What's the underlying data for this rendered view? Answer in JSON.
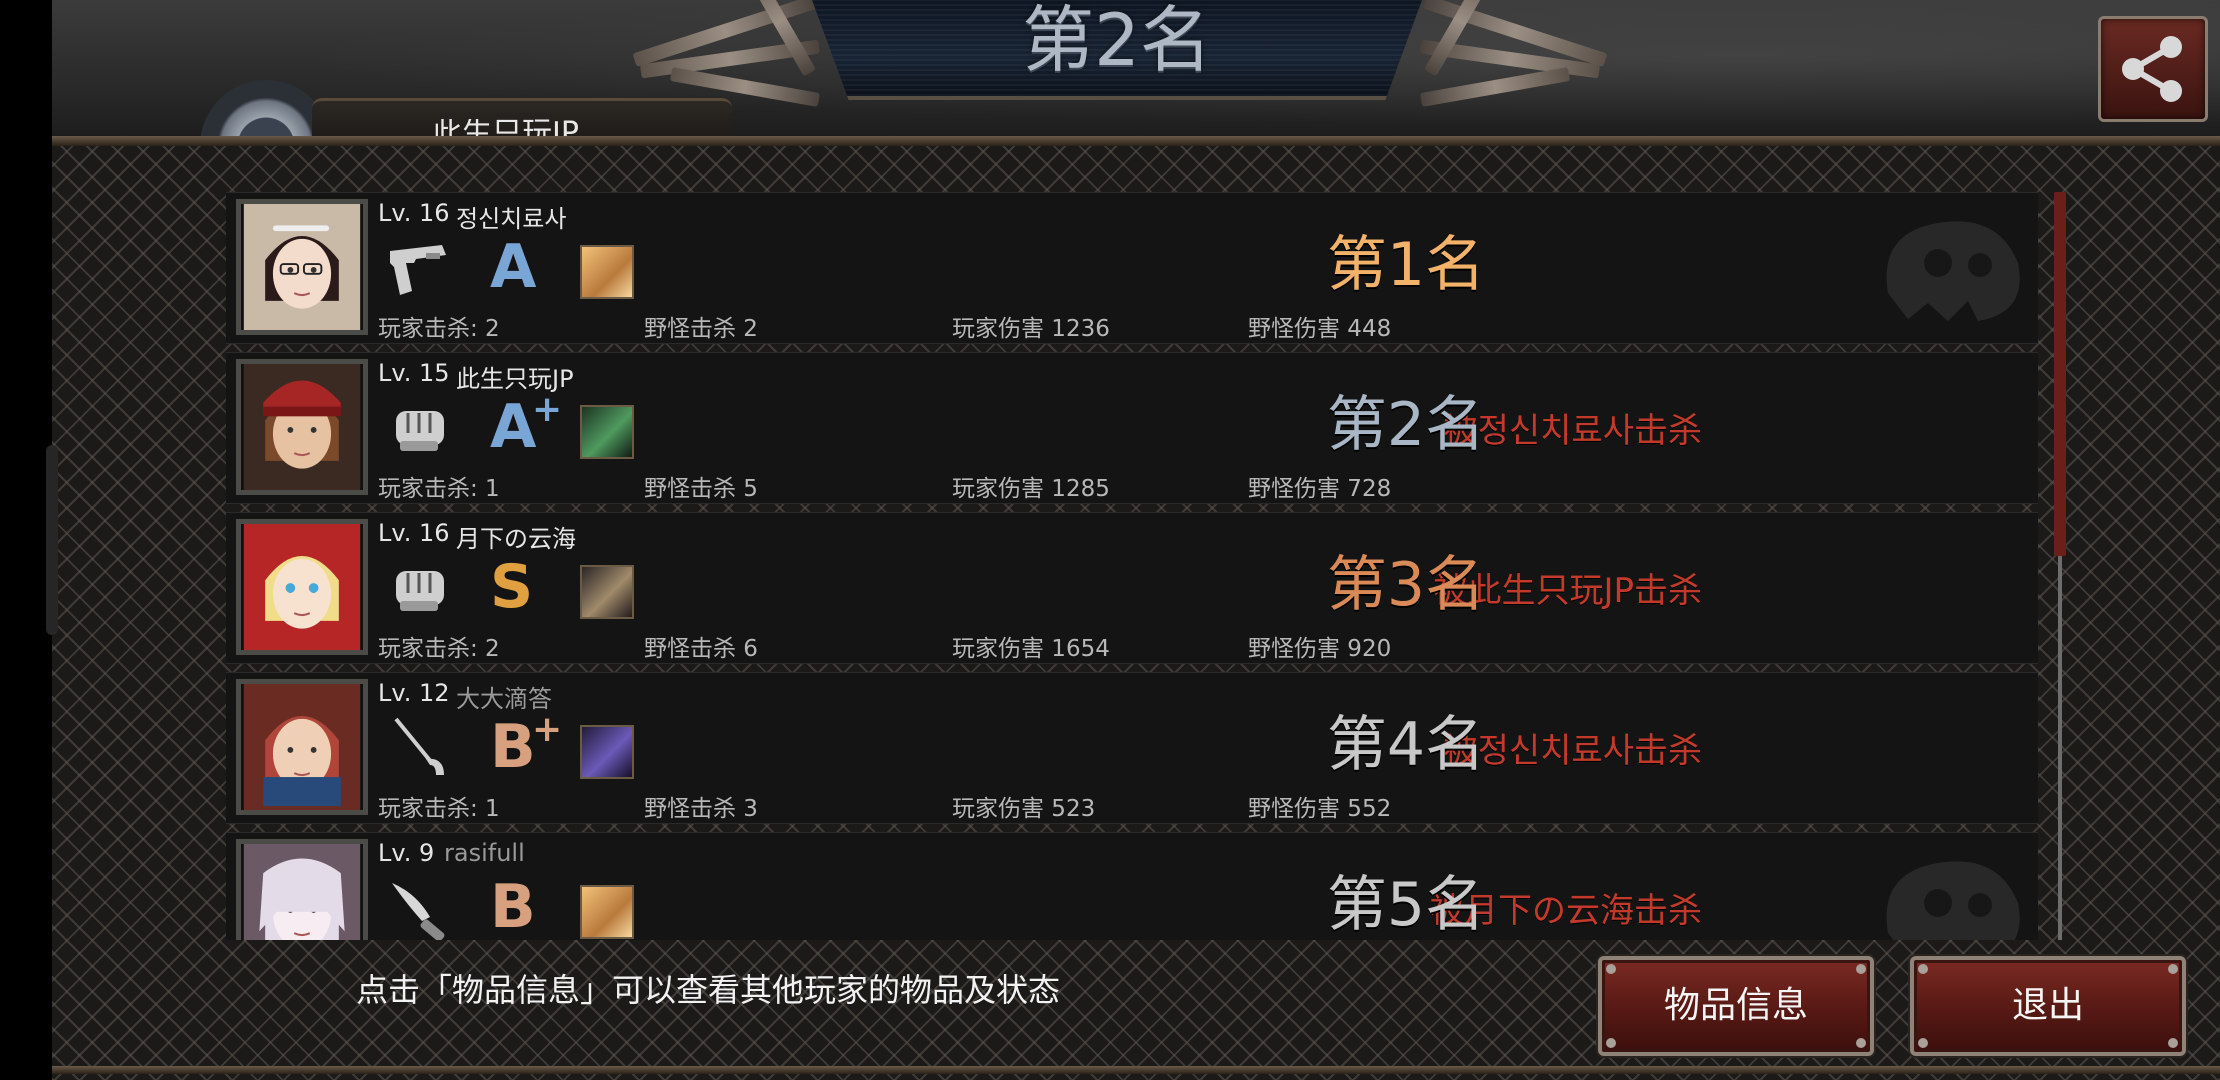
{
  "header": {
    "title": "第2名",
    "header_name_partial": "此生只玩JP"
  },
  "players": [
    {
      "level": "Lv. 16",
      "name": "정신치료사",
      "name_color": "#e6e6e6",
      "weapon": "pistol-icon",
      "grade": "A",
      "grade_plus": "",
      "grade_color": "#7aa6d6",
      "item": "gold-item-icon",
      "player_kills": "玩家击杀: 2",
      "monster_kills": "野怪击杀 2",
      "player_damage": "玩家伤害 1236",
      "monster_damage": "野怪伤害 448",
      "killed_by": "",
      "rank": "第1名",
      "rank_color": "#f2b26a",
      "portrait": "portrait-girl-glasses",
      "emblem": true
    },
    {
      "level": "Lv. 15",
      "name": "此生只玩JP",
      "name_color": "#e6e6e6",
      "weapon": "fist-icon",
      "grade": "A",
      "grade_plus": "+",
      "grade_color": "#7aa6d6",
      "item": "green-item-icon",
      "player_kills": "玩家击杀: 1",
      "monster_kills": "野怪击杀 5",
      "player_damage": "玩家伤害 1285",
      "monster_damage": "野怪伤害 728",
      "killed_by": "被정신치료사击杀",
      "rank": "第2名",
      "rank_color": "#a9b6c6",
      "portrait": "portrait-red-beanie",
      "emblem": false
    },
    {
      "level": "Lv. 16",
      "name": "月下の云海",
      "name_color": "#e6e6e6",
      "weapon": "fist-icon",
      "grade": "S",
      "grade_plus": "",
      "grade_color": "#e0a040",
      "item": "dark-character-item-icon",
      "player_kills": "玩家击杀: 2",
      "monster_kills": "野怪击杀 6",
      "player_damage": "玩家伤害 1654",
      "monster_damage": "野怪伤害 920",
      "killed_by": "被此生只玩JP击杀",
      "rank": "第3名",
      "rank_color": "#d98a56",
      "portrait": "portrait-blonde",
      "emblem": false
    },
    {
      "level": "Lv. 12",
      "name": "大大滴答",
      "name_color": "#9a9a9a",
      "weapon": "rapier-icon",
      "grade": "B",
      "grade_plus": "+",
      "grade_color": "#d7a07e",
      "item": "purple-item-icon",
      "player_kills": "玩家击杀: 1",
      "monster_kills": "野怪击杀 3",
      "player_damage": "玩家伤害 523",
      "monster_damage": "野怪伤害 552",
      "killed_by": "被정신치료사击杀",
      "rank": "第4名",
      "rank_color": "#c8c8c8",
      "portrait": "portrait-redhead",
      "emblem": false
    },
    {
      "level": "Lv. 9",
      "name": "rasifull",
      "name_color": "#9a9a9a",
      "weapon": "knife-icon",
      "grade": "B",
      "grade_plus": "",
      "grade_color": "#d7a07e",
      "item": "gold-item-icon",
      "player_kills": "",
      "monster_kills": "",
      "player_damage": "",
      "monster_damage": "",
      "killed_by": "被月下の云海击杀",
      "rank": "第5名",
      "rank_color": "#c8c8c8",
      "portrait": "portrait-white-hair",
      "emblem": true
    }
  ],
  "footer": {
    "hint": "点击「物品信息」可以查看其他玩家的物品及状态",
    "item_info_button": "物品信息",
    "exit_button": "退出"
  },
  "colors": {
    "button_red": "#6a2119",
    "killed_by_text": "#c43a2a"
  }
}
